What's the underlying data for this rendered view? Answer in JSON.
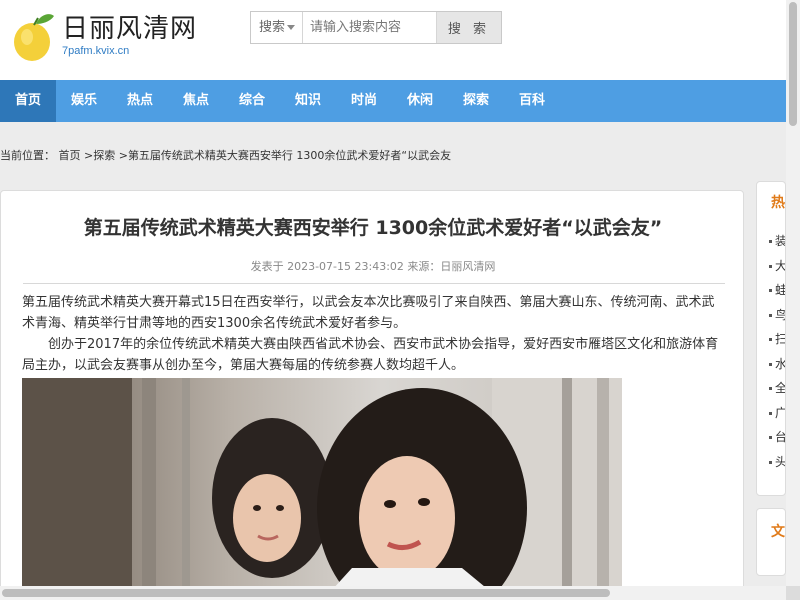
{
  "site": {
    "title": "日丽风清网",
    "domain": "7pafm.kvix.cn",
    "logo_icon": "lemon-icon"
  },
  "search": {
    "select_label": "搜索",
    "placeholder": "请输入搜索内容",
    "button_label": "搜 索"
  },
  "nav": [
    {
      "label": "首页",
      "active": true
    },
    {
      "label": "娱乐"
    },
    {
      "label": "热点"
    },
    {
      "label": "焦点"
    },
    {
      "label": "综合"
    },
    {
      "label": "知识"
    },
    {
      "label": "时尚"
    },
    {
      "label": "休闲"
    },
    {
      "label": "探索"
    },
    {
      "label": "百科"
    }
  ],
  "breadcrumb": {
    "prefix": "当前位置：",
    "home": "首页",
    "sep1": " >",
    "category": "探索",
    "sep2": " >",
    "current": "第五届传统武术精英大赛西安举行 1300余位武术爱好者“以武会友"
  },
  "article": {
    "title": "第五届传统武术精英大赛西安举行 1300余位武术爱好者“以武会友”",
    "meta": "发表于 2023-07-15 23:43:02 来源：日丽风清网",
    "paragraphs": [
      "第五届传统武术精英大赛开幕式15日在西安举行，以武会友本次比赛吸引了来自陕西、第届大赛山东、传统河南、武术武术青海、精英举行甘肃等地的西安1300余名传统武术爱好者参与。",
      "　　创办于2017年的余位传统武术精英大赛由陕西省武术协会、西安市武术协会指导，爱好西安市雁塔区文化和旅游体育局主办，以武会友赛事从创办至今，第届大赛每届的传统参赛人数均超千人。"
    ]
  },
  "sidebar": {
    "box1_heading": "热",
    "box1_items": [
      "装",
      "大",
      "蛙",
      "鸟",
      "扫",
      "水",
      "全",
      "广",
      "台",
      "头"
    ],
    "box2_heading": "文"
  },
  "colors": {
    "nav_bg": "#4e9ee3",
    "nav_active": "#2e77b8",
    "accent": "#e07b1a",
    "link": "#2f7cc4"
  }
}
